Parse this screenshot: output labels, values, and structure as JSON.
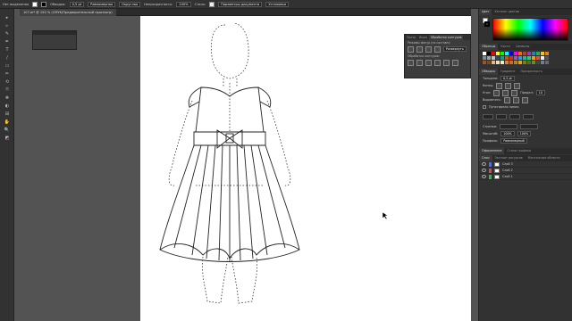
{
  "control_bar": {
    "selection_label": "Нет выделения",
    "stroke_label": "Обводка:",
    "stroke_value": "0,5 pt",
    "brush_label": "Равномерная",
    "profile_label": "Округлая",
    "opacity_label": "Непрозрачность:",
    "opacity_value": "100%",
    "style_label": "Стиль:",
    "doc_settings_button": "Параметры документа",
    "prefs_button": "Установки"
  },
  "document_tab": {
    "label": "107.ai* @ 150 % (CMYK/Предварительный просмотр)"
  },
  "tools": [
    "▸",
    "▹",
    "✎",
    "✒",
    "T",
    "/",
    "▭",
    "✏",
    "⟲",
    "⤧",
    "✥",
    "◐",
    "⊞",
    "✋",
    "🔍",
    "◩"
  ],
  "pathfinder": {
    "tabs": [
      "Прозр",
      "Выра",
      "Обработка контуров"
    ],
    "shape_modes_label": "Режимы фигур (по составн):",
    "pathfinders_label": "Обработка контуров:",
    "expand_button": "Развернуть"
  },
  "right_panel": {
    "color_tabs": [
      "Цвет",
      "Каталог цветов"
    ],
    "swatch_tabs": [
      "Образцы",
      "Кисти",
      "Символы"
    ],
    "stroke_tabs": [
      "Обводка",
      "Градиент",
      "Прозрачность"
    ],
    "stroke_weight_label": "Толщина:",
    "stroke_weight_value": "0,5 pt",
    "cap_label": "Конец:",
    "corner_label": "Угол:",
    "limit_label": "Предел:",
    "limit_value": "10",
    "align_label": "Выровнять:",
    "dashed_label": "Пунктирная линия",
    "arrows_label": "Стрелки:",
    "scale_label": "Масштаб:",
    "scale_value_1": "100%",
    "scale_value_2": "100%",
    "profile_label": "Профиль:",
    "profile_value": "Равномерный",
    "appearance_tabs": [
      "Оформление",
      "Стили графики"
    ],
    "layers_tabs": [
      "Слои",
      "Экспорт ресурсов",
      "Монтажные области"
    ],
    "layers": [
      "Слой 3",
      "Слой 2",
      "Слой 1"
    ],
    "layer_colors": [
      "#4a6cf7",
      "#e34545",
      "#3ab54a"
    ]
  },
  "swatch_colors": [
    "#ffffff",
    "#000000",
    "#ff0000",
    "#ffff00",
    "#00ff00",
    "#00ffff",
    "#0000ff",
    "#ff00ff",
    "#ff6600",
    "#c0392b",
    "#8e44ad",
    "#2980b9",
    "#27ae60",
    "#f1c40f",
    "#e67e22",
    "#7f8c8d",
    "#95a5a6",
    "#bdc3c7",
    "#34495e",
    "#16a085",
    "#d35400",
    "#c0392b",
    "#9b59b6",
    "#3498db",
    "#1abc9c",
    "#2ecc71",
    "#f39c12",
    "#e74c3c",
    "#ecf0f1",
    "#555555",
    "#a0522d",
    "#8b4513",
    "#deb887",
    "#f5deb3",
    "#ffe4c4",
    "#cd853f",
    "#d2691e",
    "#b8860b",
    "#daa520",
    "#808000",
    "#556b2f",
    "#6b8e23",
    "#2f4f4f",
    "#708090",
    "#696969"
  ]
}
